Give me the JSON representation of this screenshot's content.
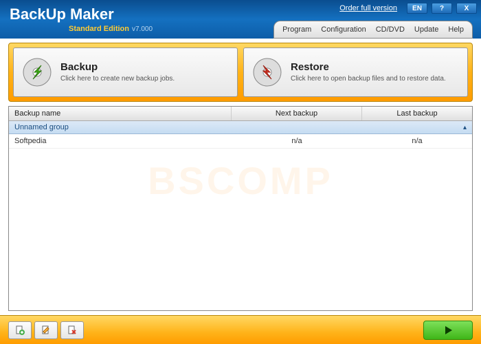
{
  "titlebar": {
    "app_name": "BackUp Maker",
    "edition": "Standard Edition",
    "version": "v7.000",
    "order_link": "Order full version",
    "lang": "EN",
    "help": "?",
    "close": "X"
  },
  "menu": {
    "program": "Program",
    "configuration": "Configuration",
    "cddvd": "CD/DVD",
    "update": "Update",
    "help": "Help"
  },
  "actions": {
    "backup": {
      "title": "Backup",
      "desc": "Click here to create new backup jobs."
    },
    "restore": {
      "title": "Restore",
      "desc": "Click here to open backup files and to restore data."
    }
  },
  "list": {
    "headers": {
      "name": "Backup name",
      "next": "Next backup",
      "last": "Last backup"
    },
    "group": "Unnamed group",
    "rows": [
      {
        "name": "Softpedia",
        "next": "n/a",
        "last": "n/a"
      }
    ]
  },
  "watermark": "BSCOMP"
}
